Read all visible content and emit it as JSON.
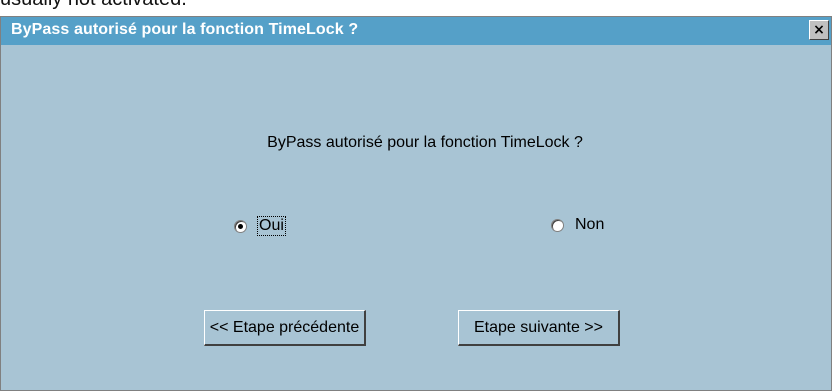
{
  "background_text": "usually not activated.",
  "dialog": {
    "title": "ByPass autorisé pour la fonction TimeLock ?",
    "close_label": "×",
    "question": "ByPass autorisé pour la fonction TimeLock ?",
    "options": [
      {
        "label": "Oui",
        "selected": true
      },
      {
        "label": "Non",
        "selected": false
      }
    ],
    "buttons": {
      "prev": "<< Etape précédente",
      "next": "Etape suivante >>"
    }
  },
  "colors": {
    "title_bar": "#55a0c8",
    "dialog_bg": "#a8c4d4"
  },
  "icons": {
    "close": "close-icon"
  }
}
